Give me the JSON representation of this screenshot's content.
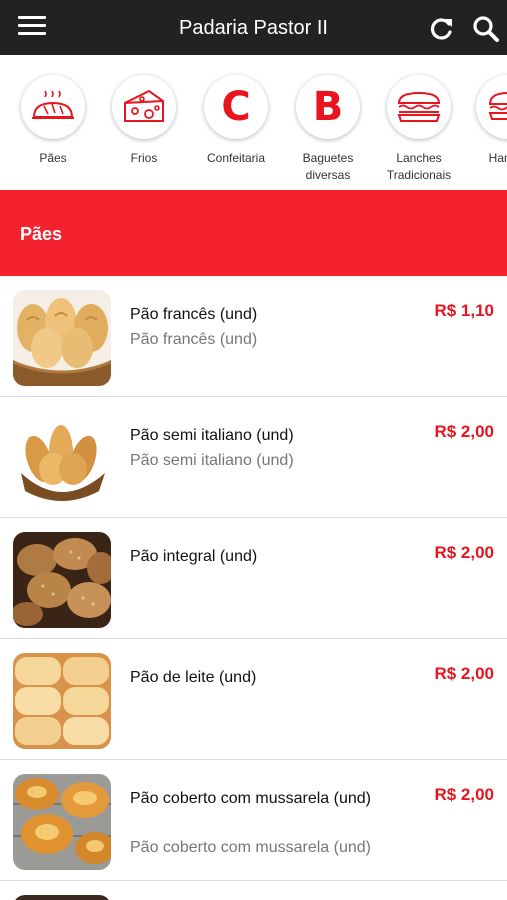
{
  "header": {
    "title": "Padaria Pastor II",
    "menu_icon": "hamburger-menu-icon",
    "refresh_icon": "refresh-icon",
    "search_icon": "search-icon"
  },
  "categories": [
    {
      "label": "Pães",
      "icon": "bread-icon"
    },
    {
      "label": "Frios",
      "icon": "cheese-icon"
    },
    {
      "label": "Confeitaria",
      "letter": "C"
    },
    {
      "label": "Baguetes diversas",
      "letter": "B"
    },
    {
      "label": "Lanches Tradicionais",
      "icon": "sandwich-icon"
    },
    {
      "label": "Hambu",
      "icon": "burger-icon"
    }
  ],
  "section": {
    "title": "Pães"
  },
  "products": [
    {
      "name": "Pão francês (und)",
      "description": "Pão francês (und)",
      "price": "R$ 1,10",
      "image": "french-bread-photo"
    },
    {
      "name": "Pão semi italiano (und)",
      "description": "Pão semi italiano (und)",
      "price": "R$ 2,00",
      "image": "italian-bread-photo"
    },
    {
      "name": "Pão integral (und)",
      "description": "",
      "price": "R$ 2,00",
      "image": "wholegrain-bread-photo"
    },
    {
      "name": "Pão de leite (und)",
      "description": "",
      "price": "R$ 2,00",
      "image": "milk-bread-photo"
    },
    {
      "name": "Pão coberto com mussarela (und)",
      "description": "Pão coberto com mussarela (und)",
      "price": "R$ 2,00",
      "image": "mozzarella-bread-photo"
    }
  ],
  "colors": {
    "accent": "#e8141e",
    "header_bg": "#222222",
    "section_bg": "#f3222e"
  }
}
